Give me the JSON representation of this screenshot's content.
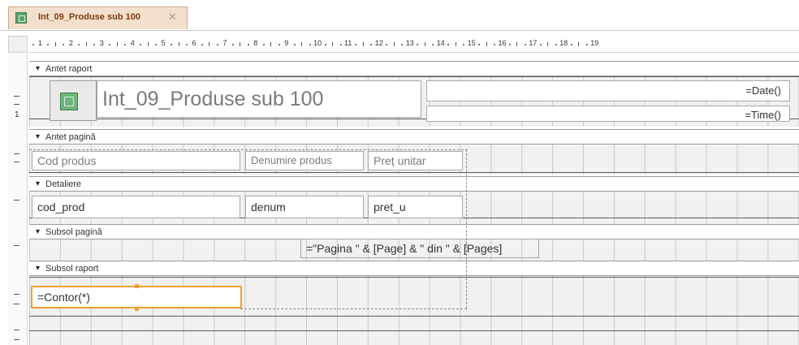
{
  "tab": {
    "label": "Int_09_Produse sub 100",
    "icon": "report-icon",
    "close_icon": "close-icon"
  },
  "ruler": {
    "numbers": [
      "1",
      "2",
      "3",
      "4",
      "5",
      "6",
      "7",
      "8",
      "9",
      "10",
      "11",
      "12",
      "13",
      "14",
      "15",
      "16",
      "17",
      "18",
      "19"
    ]
  },
  "vertical_ruler": {
    "label": "1"
  },
  "sections": {
    "report_header": "Antet raport",
    "page_header": "Antet pagină",
    "detail": "Detaliere",
    "page_footer": "Subsol pagină",
    "report_footer": "Subsol raport"
  },
  "report_header": {
    "title": "Int_09_Produse sub 100",
    "date_expr": "=Date()",
    "time_expr": "=Time()"
  },
  "page_header": {
    "labels": [
      "Cod produs",
      "Denumire produs",
      "Preț unitar"
    ]
  },
  "detail": {
    "fields": [
      "cod_prod",
      "denum",
      "pret_u"
    ]
  },
  "page_footer": {
    "page_expr": "=\"Pagina \" & [Page] & \" din \" & [Pages]"
  },
  "report_footer": {
    "count_expr": "=Contor(*)"
  },
  "colors": {
    "tab_bg": "#f3e0cc",
    "tab_text": "#7a3a10",
    "selection": "#f0a030",
    "grid": "#c9c9c9"
  }
}
